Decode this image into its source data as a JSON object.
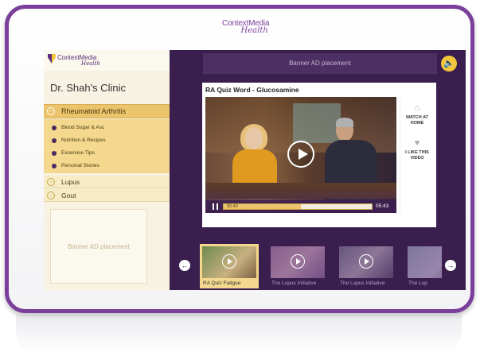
{
  "device": {
    "logo_line1": "ContextMedia",
    "logo_line2": "Health"
  },
  "sidebar": {
    "logo_line1": "ContextMedia",
    "logo_line2": "Health",
    "clinic_name": "Dr. Shah's Clinic",
    "active_category": "Rheumatoid Arthritis",
    "subitems": [
      "Blood Sugar & Asc",
      "Nutrition & Recipes",
      "Excervise Tips",
      "Personal Stories"
    ],
    "categories": [
      "Lupus",
      "Gout"
    ],
    "ad_text": "Banner AD placement"
  },
  "main": {
    "banner_text": "Banner AD placement",
    "video_title": "RA Quiz Word - Glucosamine",
    "elapsed": "00:43",
    "duration": "05:43",
    "progress": 0.52,
    "actions": [
      {
        "label": "WATCH AT HOME",
        "icon": "home-icon"
      },
      {
        "label": "I LIKE THIS VIDEO",
        "icon": "heart-icon"
      }
    ],
    "thumbnails": [
      "RA Quiz Fatigue",
      "The Lupus Initiative",
      "The Lupus Initiative",
      "The Lup"
    ]
  },
  "colors": {
    "purple": "#7a3f9a",
    "screen_bg": "#3a1f4e",
    "gold": "#ecc46c",
    "cream": "#f7f2e1"
  }
}
